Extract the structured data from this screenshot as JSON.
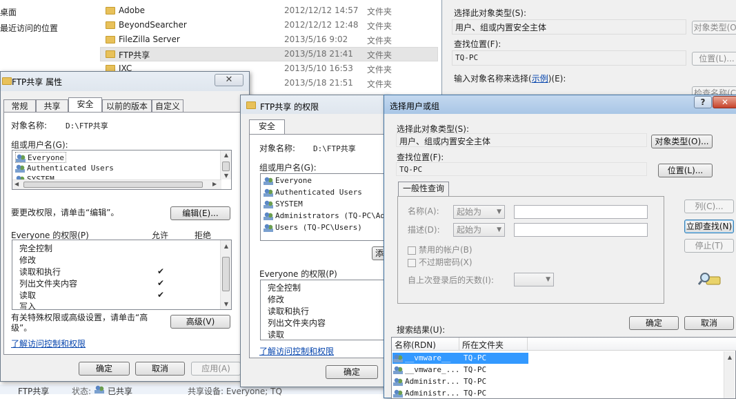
{
  "explorer": {
    "nav_items": [
      "桌面",
      "最近访问的位置"
    ],
    "files": [
      {
        "name": "Adobe",
        "date": "2012/12/12 14:57",
        "type": "文件夹"
      },
      {
        "name": "BeyondSearcher",
        "date": "2012/12/12 12:48",
        "type": "文件夹"
      },
      {
        "name": "FileZilla Server",
        "date": "2013/5/16 9:02",
        "type": "文件夹"
      },
      {
        "name": "FTP共享",
        "date": "2013/5/18 21:41",
        "type": "文件夹"
      },
      {
        "name": "JXC",
        "date": "2013/5/10 16:53",
        "type": "文件夹"
      },
      {
        "name": "",
        "date": "2013/5/18 21:51",
        "type": "文件夹"
      }
    ],
    "status": {
      "name": "FTP共享",
      "state_label": "状态:",
      "state_value": "已共享",
      "shared_label": "共享设备: Everyone; TQ"
    }
  },
  "bg_dialog": {
    "object_type_label": "选择此对象类型(S):",
    "object_type_value": "用户、组或内置安全主体",
    "object_type_button": "对象类型(O)",
    "location_label": "查找位置(F):",
    "location_value": "TQ-PC",
    "location_button": "位置(L)...",
    "enter_label_prefix": "输入对象名称来选择(",
    "enter_label_link": "示例",
    "enter_label_suffix": ")(E):",
    "check_names_button": "检查名称(C)"
  },
  "properties": {
    "title": "FTP共享 属性",
    "tabs": [
      "常规",
      "共享",
      "安全",
      "以前的版本",
      "自定义"
    ],
    "object_name_label": "对象名称:",
    "object_name_value": "D:\\FTP共享",
    "group_label": "组或用户名(G):",
    "users": [
      "Everyone",
      "Authenticated Users",
      "SYSTEM"
    ],
    "edit_hint": "要更改权限，请单击“编辑”。",
    "edit_button": "编辑(E)...",
    "perm_label": "Everyone 的权限(P)",
    "allow_label": "允许",
    "deny_label": "拒绝",
    "permissions": [
      {
        "name": "完全控制",
        "allow": ""
      },
      {
        "name": "修改",
        "allow": ""
      },
      {
        "name": "读取和执行",
        "allow": "✔"
      },
      {
        "name": "列出文件夹内容",
        "allow": "✔"
      },
      {
        "name": "读取",
        "allow": "✔"
      },
      {
        "name": "写入",
        "allow": ""
      }
    ],
    "advanced_hint_1": "有关特殊权限或高级设置，请单击“高",
    "advanced_hint_2": "级”。",
    "advanced_button": "高级(V)",
    "learn_link": "了解访问控制和权限",
    "ok": "确定",
    "cancel": "取消",
    "apply": "应用(A)"
  },
  "permissions_dialog": {
    "title": "FTP共享 的权限",
    "tab": "安全",
    "object_name_label": "对象名称:",
    "object_name_value": "D:\\FTP共享",
    "group_label": "组或用户名(G):",
    "users": [
      "Everyone",
      "Authenticated Users",
      "SYSTEM",
      "Administrators (TQ-PC\\Admi",
      "Users (TQ-PC\\Users)"
    ],
    "add_button_partial": "添",
    "perm_label": "Everyone 的权限(P)",
    "permissions": [
      "完全控制",
      "修改",
      "读取和执行",
      "列出文件夹内容",
      "读取"
    ],
    "learn_link": "了解访问控制和权限",
    "ok": "确定"
  },
  "select_dialog": {
    "title": "选择用户或组",
    "object_type_label": "选择此对象类型(S):",
    "object_type_value": "用户、组或内置安全主体",
    "object_type_button": "对象类型(O)...",
    "location_label": "查找位置(F):",
    "location_value": "TQ-PC",
    "location_button": "位置(L)...",
    "general_query_tab": "一般性查询",
    "name_label": "名称(A):",
    "name_combo": "起始为",
    "desc_label": "描述(D):",
    "desc_combo": "起始为",
    "disabled_accounts": "禁用的帐户(B)",
    "no_expire_pwd": "不过期密码(X)",
    "days_label": "自上次登录后的天数(I):",
    "columns_button": "列(C)...",
    "find_now_button": "立即查找(N)",
    "stop_button": "停止(T)",
    "ok": "确定",
    "cancel": "取消",
    "results_label": "搜索结果(U):",
    "col_name": "名称(RDN)",
    "col_folder": "所在文件夹",
    "results": [
      {
        "name": "__vmware__",
        "folder": "TQ-PC"
      },
      {
        "name": "__vmware_...",
        "folder": "TQ-PC"
      },
      {
        "name": "Administr...",
        "folder": "TQ-PC"
      },
      {
        "name": "Administr...",
        "folder": "TQ-PC"
      }
    ]
  },
  "colors": {
    "accent": "#3399ff",
    "link": "#0645ad",
    "window_bg": "#f0f0f0"
  }
}
